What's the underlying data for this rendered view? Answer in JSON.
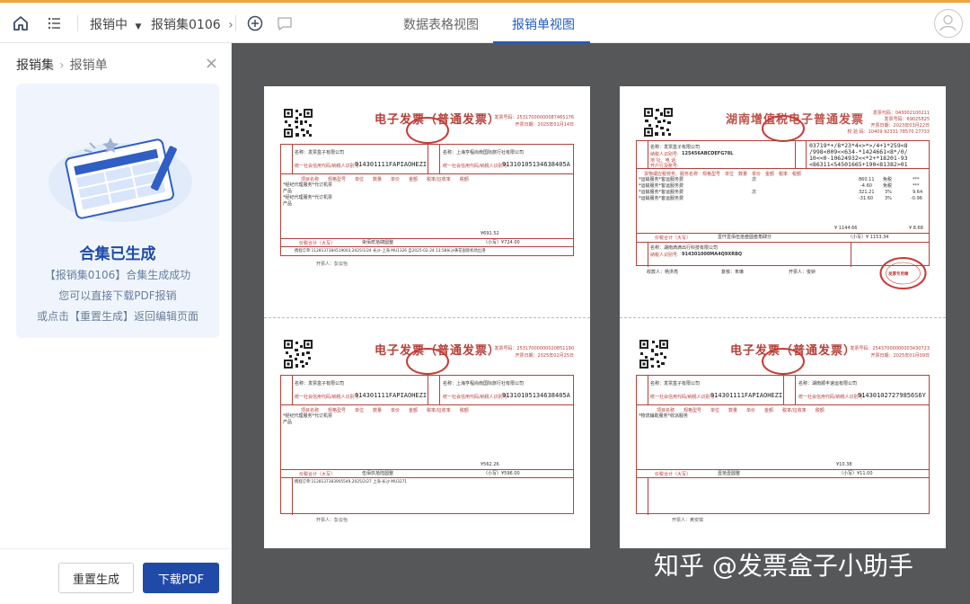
{
  "topbar": {
    "status_label": "报销中",
    "breadcrumb_label": "报销集0106",
    "tabs": [
      {
        "label": "数据表格视图",
        "active": false
      },
      {
        "label": "报销单视图",
        "active": true
      }
    ]
  },
  "sidebar": {
    "crumb_root": "报销集",
    "crumb_current": "报销单",
    "card": {
      "title": "合集已生成",
      "line1": "【报销集0106】合集生成成功",
      "line2": "您可以直接下载PDF报销",
      "line3": "或点击【重置生成】返回编辑页面"
    },
    "buttons": {
      "reset_label": "重置生成",
      "download_label": "下载PDF"
    }
  },
  "viewer": {
    "invoices": [
      {
        "title": "电子发票（普通发票）",
        "meta_lines": [
          "发票号码：25317000000087465176",
          "开票日期：2025年01月14日"
        ],
        "buyer_name": "名称：发票盒子有限公司",
        "buyer_id": "914301111FAPIAOHEZI",
        "seller_name": "名称：上海亨程尚南国际旅行社有限公司",
        "seller_id": "91310105134638405A",
        "items": [
          "*经纪代理服务*代订机票",
          "产品",
          "*经纪代理服务*代订机票",
          "产品"
        ],
        "amount_row": "¥691.52",
        "total_label": "价税合计（大写）",
        "total_words": "柒佰贰拾肆圆整",
        "total_small": "（小写）¥724.00",
        "remark": "携程订单:1128137384519003,2025/1/24 长沙-上海 MU1326 自2025-02-24 13:58长沙黄花国际机场出港",
        "issuer": "开票人：彭云怡"
      },
      {
        "title": "湖南增值税电子普通发票",
        "meta_lines": [
          "发票代码：043002100211",
          "发票号码：69025825",
          "开票日期：2023年03月22日",
          "校 验 码：10409 92331 78570 27733"
        ],
        "buyer_name": "名称：发票盒子有限公司",
        "buyer_id": "125456ABCDEFG78L",
        "password_lines": [
          "03719*+/8*23*4<>*>/4+1*259<8",
          "/998<009<<634-*1424661<8*/0/",
          "10<<0-10624932<<*2+*18201-93",
          "<86311<54501665+190<81382>01"
        ],
        "items": [
          "*运输服务*客运服务费",
          "*运输服务*客运服务费",
          "*运输服务*客运服务费",
          "*运输服务*客运服务费"
        ],
        "unit": "次",
        "amounts": [
          "860.11",
          "-4.60",
          "321.21",
          "-31.60"
        ],
        "tax_rates": [
          "免税",
          "免税",
          "3%",
          "3%"
        ],
        "taxes": [
          "***",
          "***",
          "9.64",
          "-0.96"
        ],
        "amount_total": "¥ 1144.66",
        "tax_total": "¥ 8.68",
        "total_label": "价税合计（大写）",
        "total_words": "壹仟壹佰伍拾叁圆叁角肆分",
        "total_small": "（小写）¥ 1153.34",
        "seller_name": "名称：湖南滴滴出行科技有限公司",
        "seller_id": "914301000MA4Q9XRBQ",
        "payee": "收款人：杨洪亮",
        "reviewer": "复核：朱琳",
        "issuer": "开票人：俊娇",
        "stamp_text": "发票专用章"
      },
      {
        "title": "电子发票（普通发票）",
        "meta_lines": [
          "发票号码：25317000000020851190",
          "开票日期：2025年02月25日"
        ],
        "buyer_name": "名称：发票盒子有限公司",
        "buyer_id": "914301111FAPIAOHEZI",
        "seller_name": "名称：上海亨程尚南国际旅行社有限公司",
        "seller_id": "91310105134638405A",
        "items": [
          "*经纪代理服务*代订机票",
          "产品"
        ],
        "amount_row": "¥562.26",
        "total_label": "价税合计（大写）",
        "total_words": "伍佰玖拾陆圆整",
        "total_small": "（小写）¥596.00",
        "remark": "携程订单:1128137383905549,2025/2/27 上海-长沙 MU3271",
        "issuer": "开票人：彭云怡"
      },
      {
        "title": "电子发票（普通发票）",
        "meta_lines": [
          "发票号码：25437000000003430723",
          "开票日期：2025年01月09日"
        ],
        "buyer_name": "名称：发票盒子有限公司",
        "buyer_id": "914301111FAPIAOHEZI",
        "seller_name": "名称：湖南顺丰速运有限公司",
        "seller_id": "914301027279856S6Y",
        "items": [
          "*物流辅助服务*收派服务"
        ],
        "amount_row": "¥10.38",
        "total_label": "价税合计（大写）",
        "total_words": "壹拾壹圆整",
        "total_small": "（小写）¥11.00",
        "issuer": "开票人：黄安琪"
      }
    ]
  },
  "watermark": "知乎 @发票盒子小助手"
}
